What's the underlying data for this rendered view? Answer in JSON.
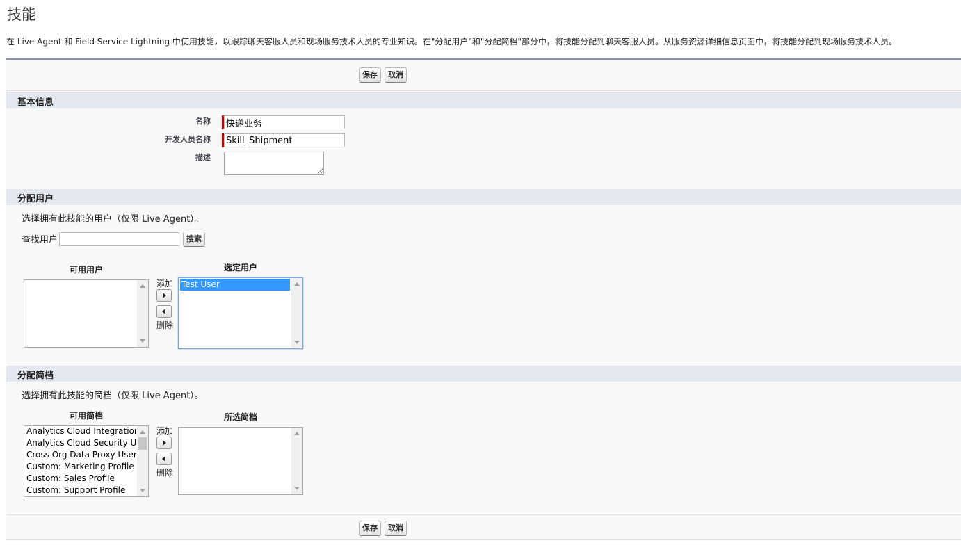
{
  "page": {
    "title": "技能",
    "description": "在 Live Agent 和 Field Service Lightning 中使用技能，以跟踪聊天客服人员和现场服务技术人员的专业知识。在\"分配用户\"和\"分配简档\"部分中，将技能分配到聊天客服人员。从服务资源详细信息页面中，将技能分配到现场服务技术人员。"
  },
  "buttons": {
    "save": "保存",
    "cancel": "取消"
  },
  "basic_info": {
    "heading": "基本信息",
    "name_label": "名称",
    "name_value": "快递业务",
    "dev_name_label": "开发人员名称",
    "dev_name_value": "Skill_Shipment",
    "desc_label": "描述",
    "desc_value": ""
  },
  "assign_users": {
    "heading": "分配用户",
    "hint": "选择拥有此技能的用户（仅限 Live Agent）。",
    "find_label": "查找用户",
    "find_value": "",
    "search_button": "搜索",
    "available_title": "可用用户",
    "available_items": [],
    "selected_title": "选定用户",
    "selected_items": [
      "Test User"
    ],
    "add_label": "添加",
    "remove_label": "删除"
  },
  "assign_profiles": {
    "heading": "分配简档",
    "hint": "选择拥有此技能的简档（仅限 Live Agent）。",
    "available_title": "可用简档",
    "available_items": [
      "Analytics Cloud Integration User",
      "Analytics Cloud Security User",
      "Cross Org Data Proxy User",
      "Custom: Marketing Profile",
      "Custom: Sales Profile",
      "Custom: Support Profile"
    ],
    "selected_title": "所选简档",
    "selected_items": [],
    "add_label": "添加",
    "remove_label": "删除"
  }
}
